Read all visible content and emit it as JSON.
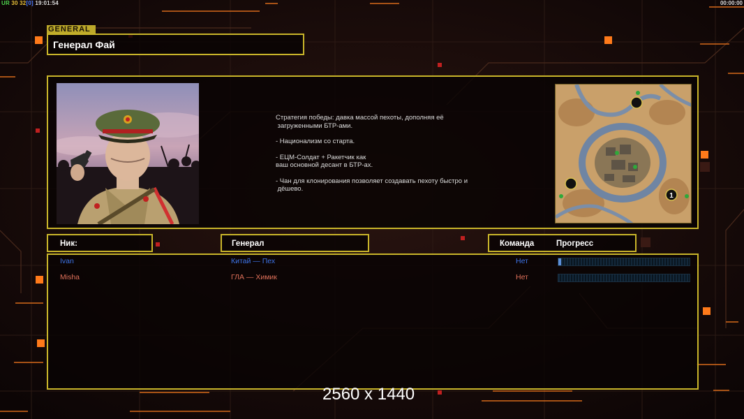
{
  "hud": {
    "left_label": "UR",
    "left_num1": "30",
    "left_num2": "32",
    "left_bracket": "0",
    "clock": "19:01:54",
    "timer": "00:00:00"
  },
  "general": {
    "tag": "GENERAL",
    "name": "Генерал Фай",
    "description": [
      "Стратегия победы: давка массой пехоты, дополняя её\n загруженными БТР-ами.",
      "- Национализм со старта.",
      "- ЕЦМ-Солдат + Ракетчик как\nваш основной десант в БТР-ах.",
      "- Чан для клонирования позволяет создавать пехоту быстро и\n дёшево."
    ]
  },
  "table": {
    "headers": {
      "nick": "Ник:",
      "general": "Генерал",
      "team": "Команда",
      "progress": "Прогресс"
    },
    "players": [
      {
        "nick": "Ivan",
        "general": "Китай — Пех",
        "team": "Нет",
        "progress": 0.02,
        "color": "#3e74e8"
      },
      {
        "nick": "Misha",
        "general": "ГЛА — Химик",
        "team": "Нет",
        "progress": 0.0,
        "color": "#e0715a"
      }
    ]
  },
  "map": {
    "start_marker": "1"
  },
  "watermark": "2560 x 1440",
  "colors": {
    "frame": "#c9b52a",
    "accent_orange": "#ff7a1a",
    "background": "#120808"
  }
}
